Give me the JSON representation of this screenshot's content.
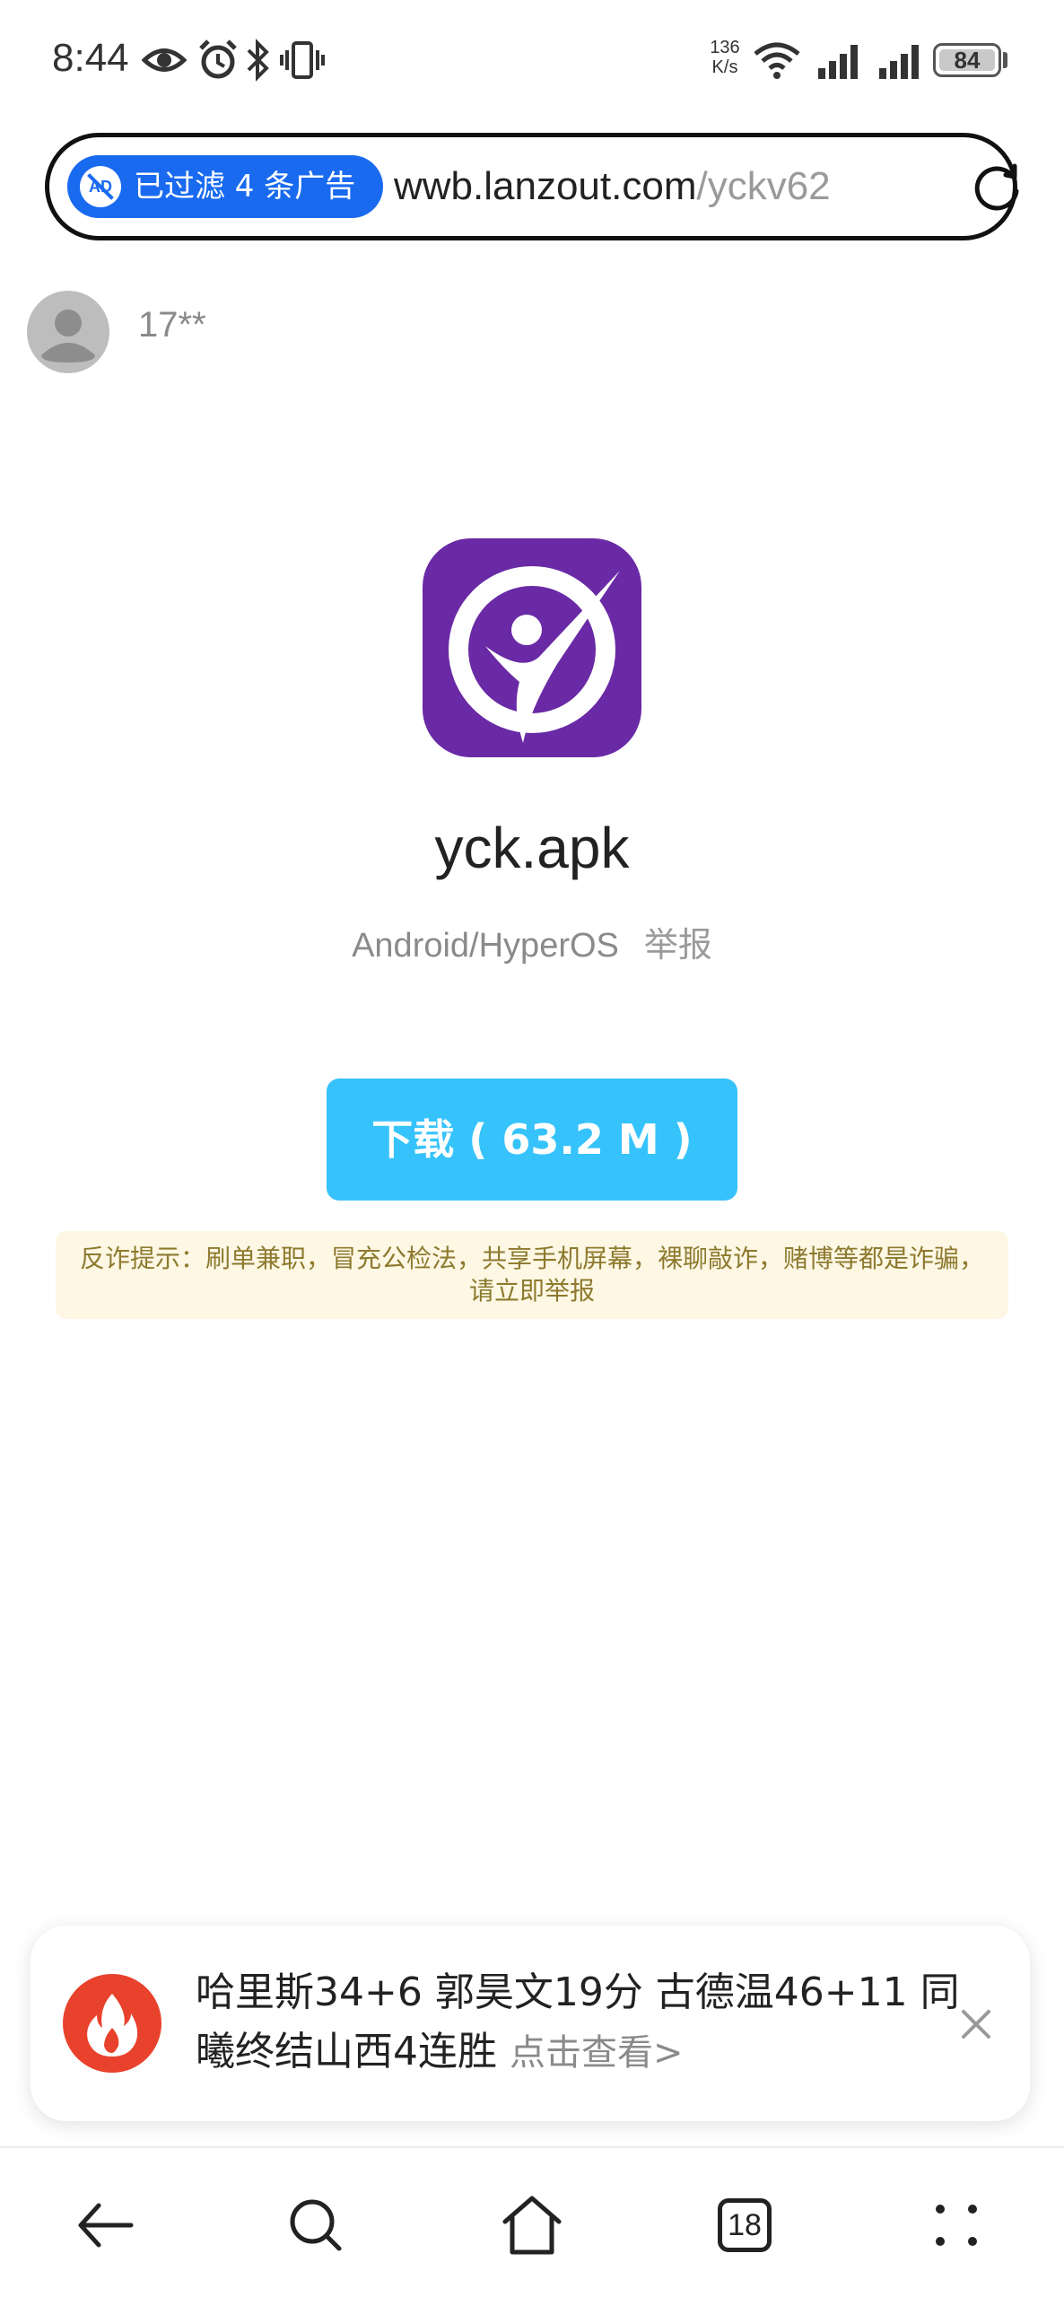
{
  "status_bar": {
    "time": "8:44",
    "net_speed_value": "136",
    "net_speed_unit": "K/s",
    "battery": "84"
  },
  "url_bar": {
    "ad_badge": "AD",
    "ad_filter_text": "已过滤 4 条广告",
    "url_host": "wwb.lanzout.com",
    "url_path": "/yckv62"
  },
  "user": {
    "name": "17**"
  },
  "file": {
    "name": "yck.apk",
    "platform": "Android/HyperOS",
    "report_label": "举报",
    "download_label": "下载 ( 63.2 M )",
    "warning": "反诈提示：刷单兼职，冒充公检法，共享手机屏幕，裸聊敲诈，赌博等都是诈骗，请立即举报"
  },
  "news_card": {
    "headline": "哈里斯34+6 郭昊文19分 古德温46+11 同曦终结山西4连胜",
    "more_label": "点击查看>"
  },
  "bottom_nav": {
    "tab_count": "18"
  },
  "colors": {
    "accent_blue": "#1a6af0",
    "download_button": "#36c3fb",
    "app_icon_purple": "#6a2aa6",
    "warning_bg": "#fdf7e4",
    "news_icon_red": "#e8412c"
  }
}
